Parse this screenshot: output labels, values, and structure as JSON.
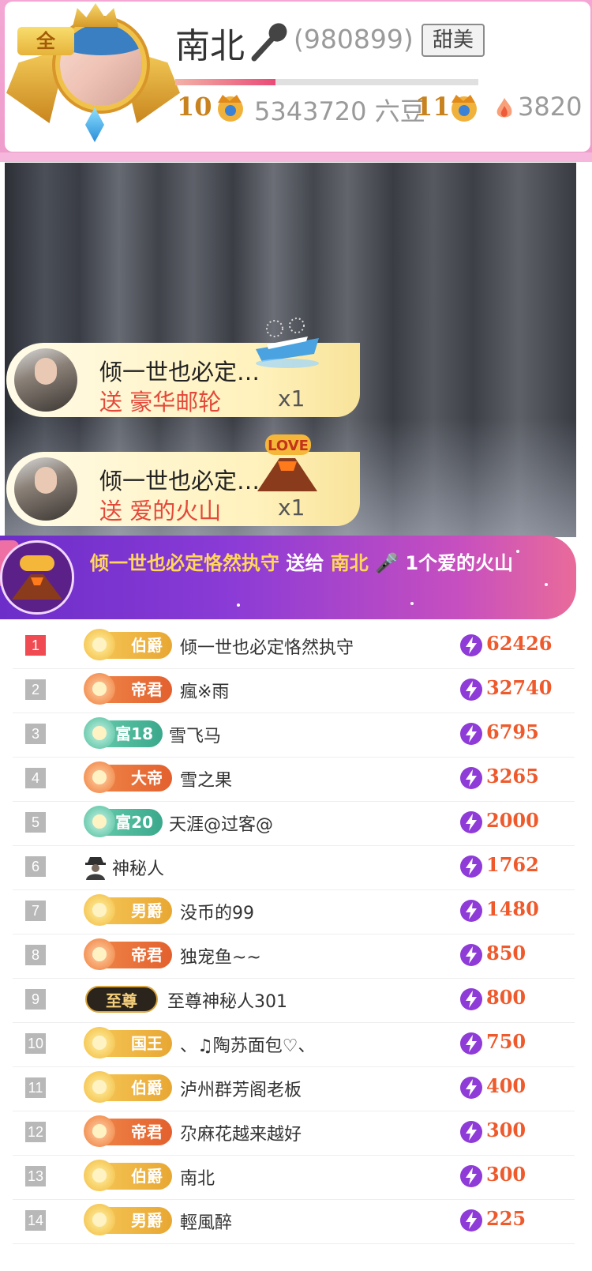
{
  "header": {
    "all_tag": "全",
    "host_name": "南北",
    "host_id": "(980899)",
    "style_tag": "甜美",
    "level_progress": 0.33,
    "host_level": "10",
    "beans": "5343720 六豆",
    "fortune_level": "11",
    "fire_count": "3820"
  },
  "gift_feed": [
    {
      "sender": "倾一世也必定…",
      "send_line": "送 豪华邮轮",
      "count": "x1",
      "gift_icon": "cruise-ship-icon"
    },
    {
      "sender": "倾一世也必定…",
      "send_line": "送 爱的火山",
      "count": "x1",
      "gift_icon": "love-volcano-icon"
    }
  ],
  "broadcast": {
    "sender": "倾一世也必定恪然执守",
    "verb": " 送给 ",
    "receiver": "南北",
    "gift": " 1个爱的火山"
  },
  "colors": {
    "header_pink": "#f4a7d4",
    "rank_first": "#f04b53",
    "score_text": "#ee5a2c",
    "broadcast_start": "#6c2dc9",
    "broadcast_end": "#e96b9a"
  },
  "ranking": [
    {
      "rank": "1",
      "badge": "伯爵",
      "badge_style": "gold",
      "name": "倾一世也必定恪然执守",
      "score": "62426"
    },
    {
      "rank": "2",
      "badge": "帝君",
      "badge_style": "orange",
      "name": "瘋※雨",
      "score": "32740"
    },
    {
      "rank": "3",
      "badge": "富18",
      "badge_style": "green",
      "name": "雪飞马",
      "score": "6795"
    },
    {
      "rank": "4",
      "badge": "大帝",
      "badge_style": "orange",
      "name": "雪之果",
      "score": "3265"
    },
    {
      "rank": "5",
      "badge": "富20",
      "badge_style": "green",
      "name": "天涯@过客@",
      "score": "2000"
    },
    {
      "rank": "6",
      "badge": "",
      "badge_style": "none",
      "name": "神秘人",
      "score": "1762"
    },
    {
      "rank": "7",
      "badge": "男爵",
      "badge_style": "gold",
      "name": "没币的99",
      "score": "1480"
    },
    {
      "rank": "8",
      "badge": "帝君",
      "badge_style": "orange",
      "name": "独宠鱼~~",
      "score": "850"
    },
    {
      "rank": "9",
      "badge": "至尊",
      "badge_style": "dark",
      "name": "至尊神秘人301",
      "score": "800"
    },
    {
      "rank": "10",
      "badge": "国王",
      "badge_style": "gold",
      "name": "、♫陶苏面包♡、",
      "score": "750"
    },
    {
      "rank": "11",
      "badge": "伯爵",
      "badge_style": "gold",
      "name": "泸州群芳阁老板",
      "score": "400"
    },
    {
      "rank": "12",
      "badge": "帝君",
      "badge_style": "orange",
      "name": "尕麻花越来越好",
      "score": "300"
    },
    {
      "rank": "13",
      "badge": "伯爵",
      "badge_style": "gold",
      "name": "南北",
      "score": "300"
    },
    {
      "rank": "14",
      "badge": "男爵",
      "badge_style": "gold",
      "name": "輕風醉",
      "score": "225"
    }
  ]
}
